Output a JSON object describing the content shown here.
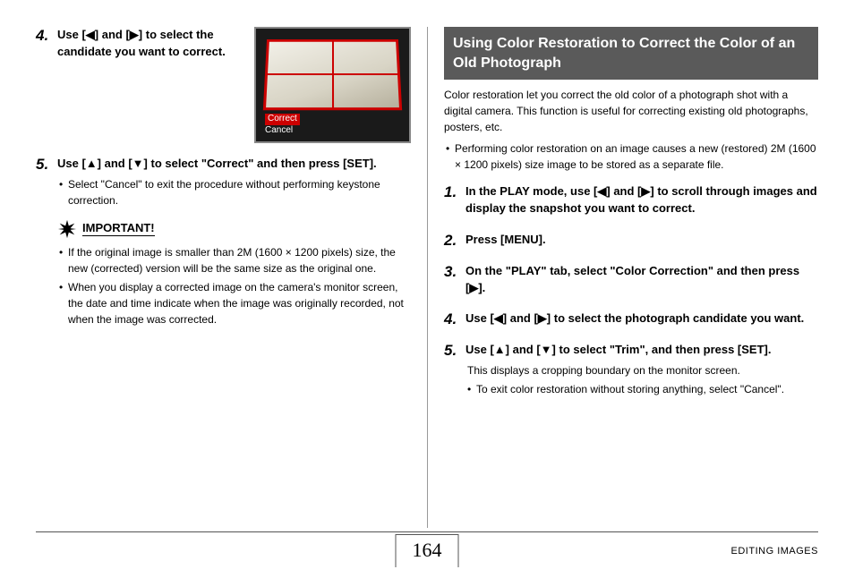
{
  "left": {
    "step4": {
      "num": "4.",
      "title_before": "Use [",
      "title_mid1": "] and [",
      "title_after": "] to select the candidate you want to correct.",
      "thumb_option_highlight": "Correct",
      "thumb_option_other": "Cancel"
    },
    "step5": {
      "num": "5.",
      "title_before": "Use [",
      "title_mid1": "] and [",
      "title_after": "] to select \"Correct\" and then press [SET].",
      "sub_bullet": "Select \"Cancel\" to exit the procedure without performing keystone correction."
    },
    "important_label": "IMPORTANT!",
    "important_bullets": [
      "If the original image is smaller than 2M (1600 × 1200 pixels) size, the new (corrected) version will be the same size as the original one.",
      "When you display a corrected image on the camera's monitor screen, the date and time indicate when the image was originally recorded, not when the image was corrected."
    ]
  },
  "right": {
    "header": "Using Color Restoration to Correct the Color of an Old Photograph",
    "intro": "Color restoration let you correct the old color of a photograph shot with a digital camera. This function is useful for correcting existing old photographs, posters, etc.",
    "intro_bullet": "Performing color restoration on an image causes a new (restored) 2M (1600 × 1200 pixels) size image to be stored as a separate file.",
    "steps": {
      "s1": {
        "num": "1.",
        "before": "In the PLAY mode, use [",
        "mid": "] and [",
        "after": "] to scroll through images and display the snapshot you want to correct."
      },
      "s2": {
        "num": "2.",
        "text": "Press [MENU]."
      },
      "s3": {
        "num": "3.",
        "before": "On the \"PLAY\" tab, select \"Color Correction\" and then press [",
        "after": "]."
      },
      "s4": {
        "num": "4.",
        "before": "Use [",
        "mid": "] and [",
        "after": "] to select the photograph candidate you want."
      },
      "s5": {
        "num": "5.",
        "before": "Use [",
        "mid": "] and [",
        "after": "] to select \"Trim\", and then press [SET].",
        "sub": "This displays a cropping boundary on the monitor screen.",
        "sub_bullet": "To exit color restoration without storing anything, select \"Cancel\"."
      }
    }
  },
  "footer": {
    "page_num": "164",
    "section": "EDITING IMAGES"
  },
  "glyphs": {
    "left": "◀",
    "right": "▶",
    "up": "▲",
    "down": "▼"
  }
}
